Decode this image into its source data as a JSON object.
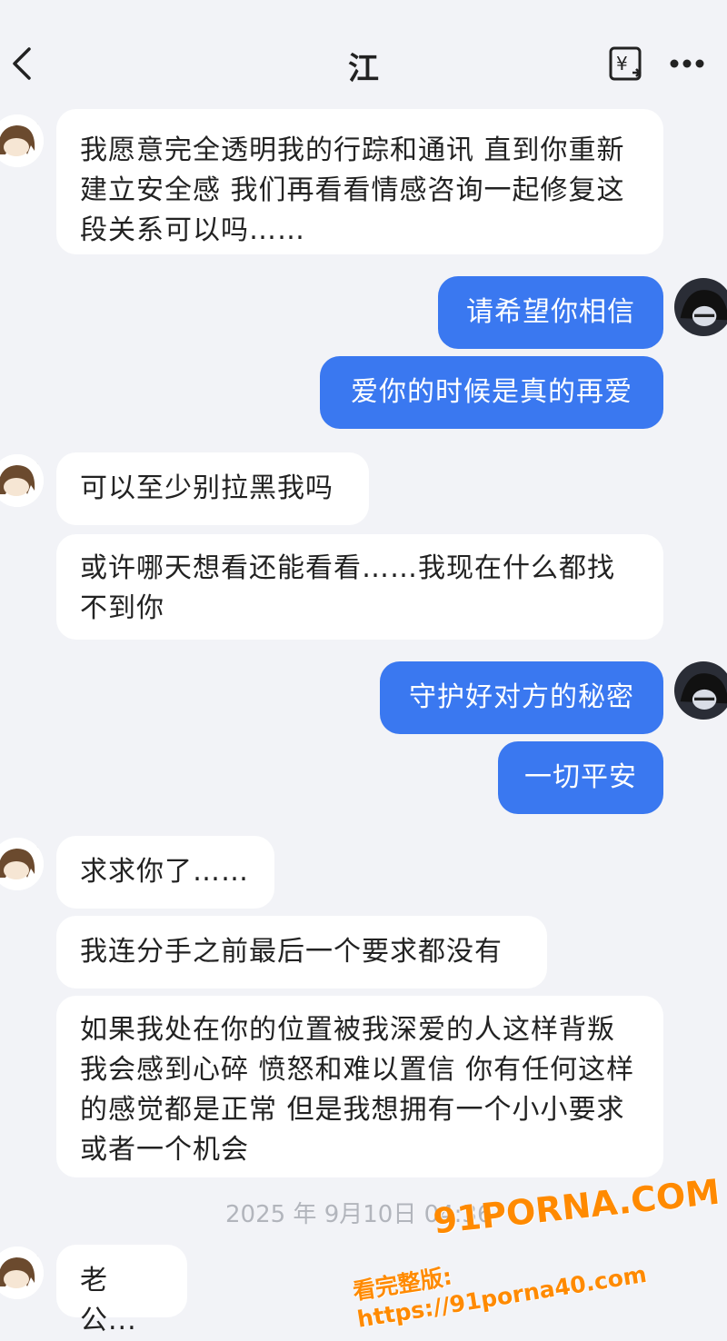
{
  "header": {
    "title": "江",
    "back_icon": "chevron-left-icon",
    "translate_icon": "translate-icon",
    "more_icon": "more-dots-icon"
  },
  "messages": [
    {
      "side": "in",
      "text": "我愿意完全透明我的行踪和通讯 直到你重新建立安全感 我们再看看情感咨询一起修复这段关系可以吗……"
    },
    {
      "side": "out",
      "text": "请希望你相信"
    },
    {
      "side": "out",
      "text": "爱你的时候是真的再爱"
    },
    {
      "side": "in",
      "text": "可以至少别拉黑我吗"
    },
    {
      "side": "in",
      "text": "或许哪天想看还能看看……我现在什么都找不到你"
    },
    {
      "side": "out",
      "text": "守护好对方的秘密"
    },
    {
      "side": "out",
      "text": "一切平安"
    },
    {
      "side": "in",
      "text": "求求你了……"
    },
    {
      "side": "in",
      "text": "我连分手之前最后一个要求都没有"
    },
    {
      "side": "in",
      "text": "如果我处在你的位置被我深爱的人这样背叛 我会感到心碎 愤怒和难以置信 你有任何这样的感觉都是正常 但是我想拥有一个小小要求或者一个机会"
    },
    {
      "side": "in",
      "text": "老公..."
    }
  ],
  "timestamp": "2025 年 9月10日 04:36",
  "watermark": {
    "site": "91PORNA.COM",
    "line": "看完整版: https://91porna40.com"
  },
  "colors": {
    "background": "#f2f3f7",
    "incoming_bubble": "#ffffff",
    "outgoing_bubble": "#3a78f0",
    "watermark": "#ff8a00"
  }
}
